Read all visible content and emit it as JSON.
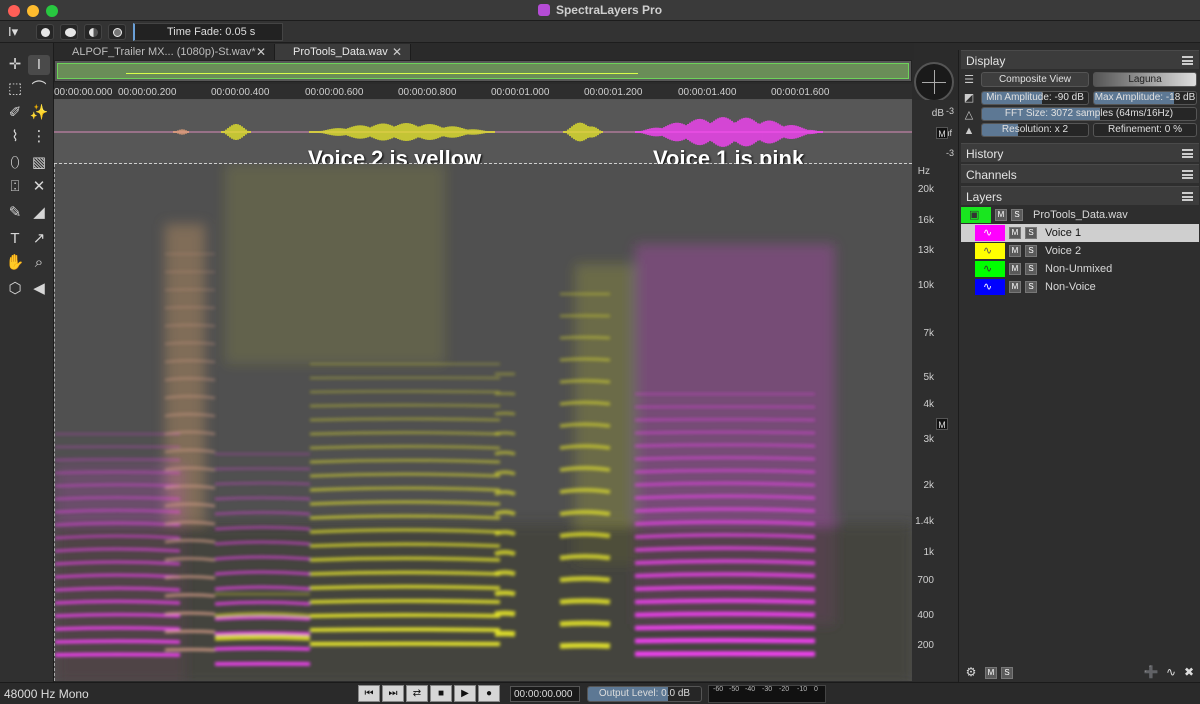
{
  "window": {
    "title": "SpectraLayers Pro"
  },
  "options": {
    "time_fade": "Time Fade: 0.05 s"
  },
  "tabs": [
    {
      "label": "ALPOF_Trailer MX... (1080p)-St.wav*"
    },
    {
      "label": "ProTools_Data.wav"
    }
  ],
  "ruler": {
    "ticks": [
      "00:00:00.000",
      "00:00:00.200",
      "00:00:00.400",
      "00:00:00.600",
      "00:00:00.800",
      "00:00:01.000",
      "00:00:01.200",
      "00:00:01.400",
      "00:00:01.600"
    ]
  },
  "annotations": {
    "voice2": "Voice 2 is yellow",
    "voice1": "Voice 1 is pink"
  },
  "wave_scale": {
    "unit": "dB",
    "labels": [
      "-3",
      "-inf",
      "-3"
    ],
    "m": "M"
  },
  "freq_scale": {
    "unit": "Hz",
    "labels": [
      "20k",
      "16k",
      "13k",
      "10k",
      "7k",
      "5k",
      "4k",
      "3k",
      "2k",
      "1.4k",
      "1k",
      "700",
      "400",
      "200"
    ],
    "m": "M"
  },
  "display_panel": {
    "title": "Display",
    "composite_view": "Composite View",
    "colormap": "Laguna",
    "min_amplitude": "Min Amplitude: -90 dB",
    "max_amplitude": "Max Amplitude: -18 dB",
    "fft_size": "FFT Size: 3072 samples (64ms/16Hz)",
    "resolution": "Resolution: x 2",
    "refinement": "Refinement: 0 %"
  },
  "history_panel": {
    "title": "History"
  },
  "channels_panel": {
    "title": "Channels"
  },
  "layers_panel": {
    "title": "Layers",
    "items": [
      {
        "name": "ProTools_Data.wav",
        "color": "#19e61f"
      },
      {
        "name": "Voice 1",
        "color": "#ff00ff"
      },
      {
        "name": "Voice 2",
        "color": "#ffff00"
      },
      {
        "name": "Non-Unmixed",
        "color": "#00ff00"
      },
      {
        "name": "Non-Voice",
        "color": "#0000ff"
      }
    ],
    "m": "M",
    "s": "S"
  },
  "status": {
    "format": "48000 Hz Mono",
    "timecode": "00:00:00.000",
    "output_level": "Output Level: 0.0 dB",
    "meter_labels": [
      "-60",
      "-50",
      "-40",
      "-30",
      "-20",
      "-10",
      "0"
    ]
  },
  "colors": {
    "voice1": "#ff40ff",
    "voice2": "#e8e82a",
    "accent": "#5d7894"
  }
}
